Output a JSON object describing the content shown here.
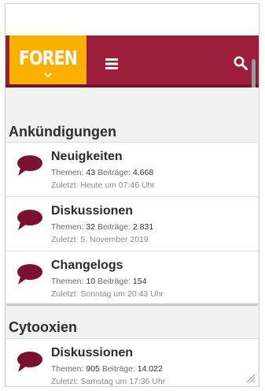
{
  "header": {
    "logo_text": "FOREN",
    "icons": [
      "chevron-down-icon",
      "menu-icon",
      "search-icon"
    ],
    "colors": {
      "nav": "#9b1e3b",
      "tab": "#fbb000",
      "bubble": "#7a1130"
    }
  },
  "sections": [
    {
      "title": "Ankündigungen",
      "forums": [
        {
          "name": "Neuigkeiten",
          "themen_label": "Themen:",
          "themen": "43",
          "beitraege_label": "Beiträge:",
          "beitraege": "4.668",
          "last": "Zuletzt: Heute um 07:46 Uhr"
        },
        {
          "name": "Diskussionen",
          "themen_label": "Themen:",
          "themen": "32",
          "beitraege_label": "Beiträge:",
          "beitraege": "2.831",
          "last": "Zuletzt: 5. November 2019"
        },
        {
          "name": "Changelogs",
          "themen_label": "Themen:",
          "themen": "10",
          "beitraege_label": "Beiträge:",
          "beitraege": "154",
          "last": "Zuletzt: Sonntag um 20:43 Uhr"
        }
      ]
    },
    {
      "title": "Cytooxien",
      "forums": [
        {
          "name": "Diskussionen",
          "themen_label": "Themen:",
          "themen": "905",
          "beitraege_label": "Beiträge:",
          "beitraege": "14.022",
          "last": "Zuletzt: Samstag um 17:36 Uhr"
        }
      ]
    }
  ]
}
